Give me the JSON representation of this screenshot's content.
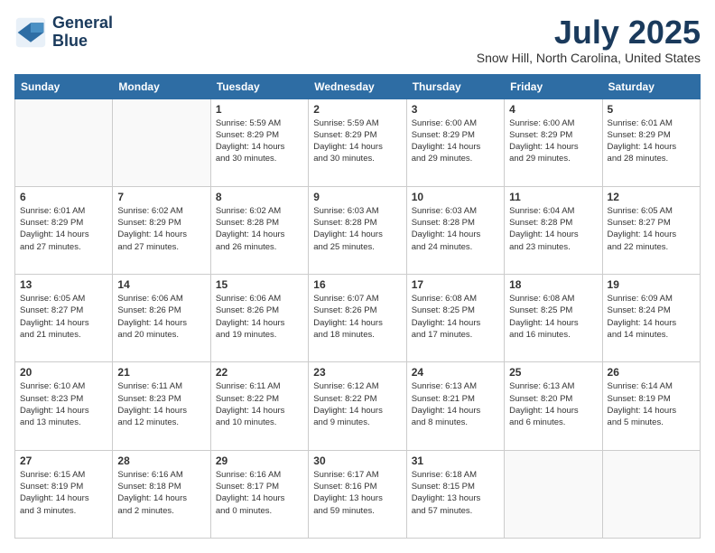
{
  "logo": {
    "line1": "General",
    "line2": "Blue"
  },
  "title": "July 2025",
  "location": "Snow Hill, North Carolina, United States",
  "days_of_week": [
    "Sunday",
    "Monday",
    "Tuesday",
    "Wednesday",
    "Thursday",
    "Friday",
    "Saturday"
  ],
  "weeks": [
    [
      {
        "day": "",
        "info": ""
      },
      {
        "day": "",
        "info": ""
      },
      {
        "day": "1",
        "info": "Sunrise: 5:59 AM\nSunset: 8:29 PM\nDaylight: 14 hours\nand 30 minutes."
      },
      {
        "day": "2",
        "info": "Sunrise: 5:59 AM\nSunset: 8:29 PM\nDaylight: 14 hours\nand 30 minutes."
      },
      {
        "day": "3",
        "info": "Sunrise: 6:00 AM\nSunset: 8:29 PM\nDaylight: 14 hours\nand 29 minutes."
      },
      {
        "day": "4",
        "info": "Sunrise: 6:00 AM\nSunset: 8:29 PM\nDaylight: 14 hours\nand 29 minutes."
      },
      {
        "day": "5",
        "info": "Sunrise: 6:01 AM\nSunset: 8:29 PM\nDaylight: 14 hours\nand 28 minutes."
      }
    ],
    [
      {
        "day": "6",
        "info": "Sunrise: 6:01 AM\nSunset: 8:29 PM\nDaylight: 14 hours\nand 27 minutes."
      },
      {
        "day": "7",
        "info": "Sunrise: 6:02 AM\nSunset: 8:29 PM\nDaylight: 14 hours\nand 27 minutes."
      },
      {
        "day": "8",
        "info": "Sunrise: 6:02 AM\nSunset: 8:28 PM\nDaylight: 14 hours\nand 26 minutes."
      },
      {
        "day": "9",
        "info": "Sunrise: 6:03 AM\nSunset: 8:28 PM\nDaylight: 14 hours\nand 25 minutes."
      },
      {
        "day": "10",
        "info": "Sunrise: 6:03 AM\nSunset: 8:28 PM\nDaylight: 14 hours\nand 24 minutes."
      },
      {
        "day": "11",
        "info": "Sunrise: 6:04 AM\nSunset: 8:28 PM\nDaylight: 14 hours\nand 23 minutes."
      },
      {
        "day": "12",
        "info": "Sunrise: 6:05 AM\nSunset: 8:27 PM\nDaylight: 14 hours\nand 22 minutes."
      }
    ],
    [
      {
        "day": "13",
        "info": "Sunrise: 6:05 AM\nSunset: 8:27 PM\nDaylight: 14 hours\nand 21 minutes."
      },
      {
        "day": "14",
        "info": "Sunrise: 6:06 AM\nSunset: 8:26 PM\nDaylight: 14 hours\nand 20 minutes."
      },
      {
        "day": "15",
        "info": "Sunrise: 6:06 AM\nSunset: 8:26 PM\nDaylight: 14 hours\nand 19 minutes."
      },
      {
        "day": "16",
        "info": "Sunrise: 6:07 AM\nSunset: 8:26 PM\nDaylight: 14 hours\nand 18 minutes."
      },
      {
        "day": "17",
        "info": "Sunrise: 6:08 AM\nSunset: 8:25 PM\nDaylight: 14 hours\nand 17 minutes."
      },
      {
        "day": "18",
        "info": "Sunrise: 6:08 AM\nSunset: 8:25 PM\nDaylight: 14 hours\nand 16 minutes."
      },
      {
        "day": "19",
        "info": "Sunrise: 6:09 AM\nSunset: 8:24 PM\nDaylight: 14 hours\nand 14 minutes."
      }
    ],
    [
      {
        "day": "20",
        "info": "Sunrise: 6:10 AM\nSunset: 8:23 PM\nDaylight: 14 hours\nand 13 minutes."
      },
      {
        "day": "21",
        "info": "Sunrise: 6:11 AM\nSunset: 8:23 PM\nDaylight: 14 hours\nand 12 minutes."
      },
      {
        "day": "22",
        "info": "Sunrise: 6:11 AM\nSunset: 8:22 PM\nDaylight: 14 hours\nand 10 minutes."
      },
      {
        "day": "23",
        "info": "Sunrise: 6:12 AM\nSunset: 8:22 PM\nDaylight: 14 hours\nand 9 minutes."
      },
      {
        "day": "24",
        "info": "Sunrise: 6:13 AM\nSunset: 8:21 PM\nDaylight: 14 hours\nand 8 minutes."
      },
      {
        "day": "25",
        "info": "Sunrise: 6:13 AM\nSunset: 8:20 PM\nDaylight: 14 hours\nand 6 minutes."
      },
      {
        "day": "26",
        "info": "Sunrise: 6:14 AM\nSunset: 8:19 PM\nDaylight: 14 hours\nand 5 minutes."
      }
    ],
    [
      {
        "day": "27",
        "info": "Sunrise: 6:15 AM\nSunset: 8:19 PM\nDaylight: 14 hours\nand 3 minutes."
      },
      {
        "day": "28",
        "info": "Sunrise: 6:16 AM\nSunset: 8:18 PM\nDaylight: 14 hours\nand 2 minutes."
      },
      {
        "day": "29",
        "info": "Sunrise: 6:16 AM\nSunset: 8:17 PM\nDaylight: 14 hours\nand 0 minutes."
      },
      {
        "day": "30",
        "info": "Sunrise: 6:17 AM\nSunset: 8:16 PM\nDaylight: 13 hours\nand 59 minutes."
      },
      {
        "day": "31",
        "info": "Sunrise: 6:18 AM\nSunset: 8:15 PM\nDaylight: 13 hours\nand 57 minutes."
      },
      {
        "day": "",
        "info": ""
      },
      {
        "day": "",
        "info": ""
      }
    ]
  ]
}
